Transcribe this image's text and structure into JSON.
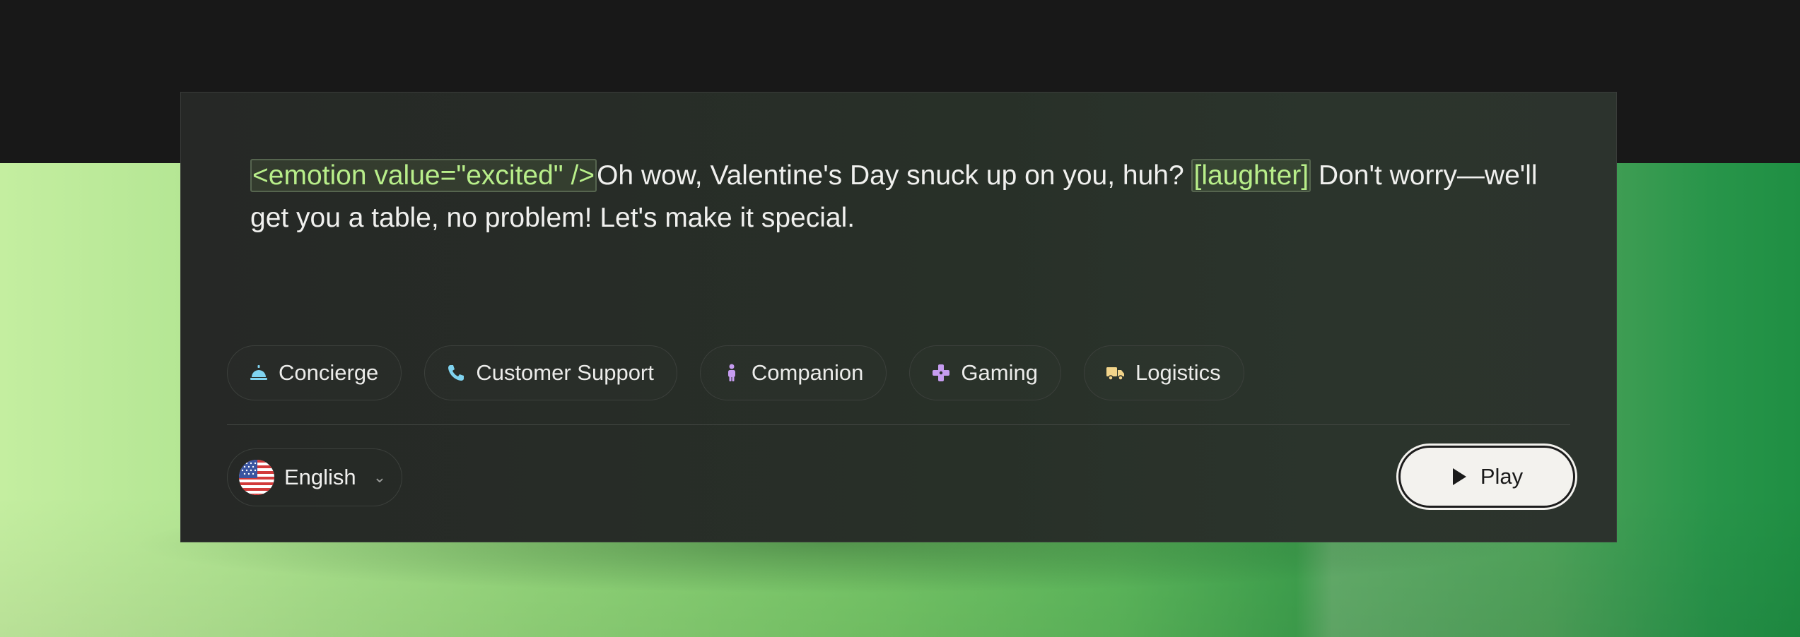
{
  "script": {
    "emotion_tag": "<emotion value=\"excited\" />",
    "text_part1": "Oh wow, Valentine's Day snuck up on you, huh? ",
    "laughter_tag": "[laughter]",
    "text_part2": " Don't worry—we'll get you a table, no problem! Let's make it special."
  },
  "use_cases": [
    {
      "label": "Concierge",
      "icon": "bell-icon",
      "color": "#7fd3f0"
    },
    {
      "label": "Customer Support",
      "icon": "phone-icon",
      "color": "#7fd3f0"
    },
    {
      "label": "Companion",
      "icon": "person-icon",
      "color": "#c69cf0"
    },
    {
      "label": "Gaming",
      "icon": "gamepad-icon",
      "color": "#c69cf0"
    },
    {
      "label": "Logistics",
      "icon": "truck-icon",
      "color": "#f2d48a"
    }
  ],
  "language": {
    "label": "English",
    "flag": "us-flag-icon"
  },
  "play": {
    "label": "Play"
  },
  "colors": {
    "tag": "#b8ee8a",
    "accent_green": "#77c868"
  }
}
